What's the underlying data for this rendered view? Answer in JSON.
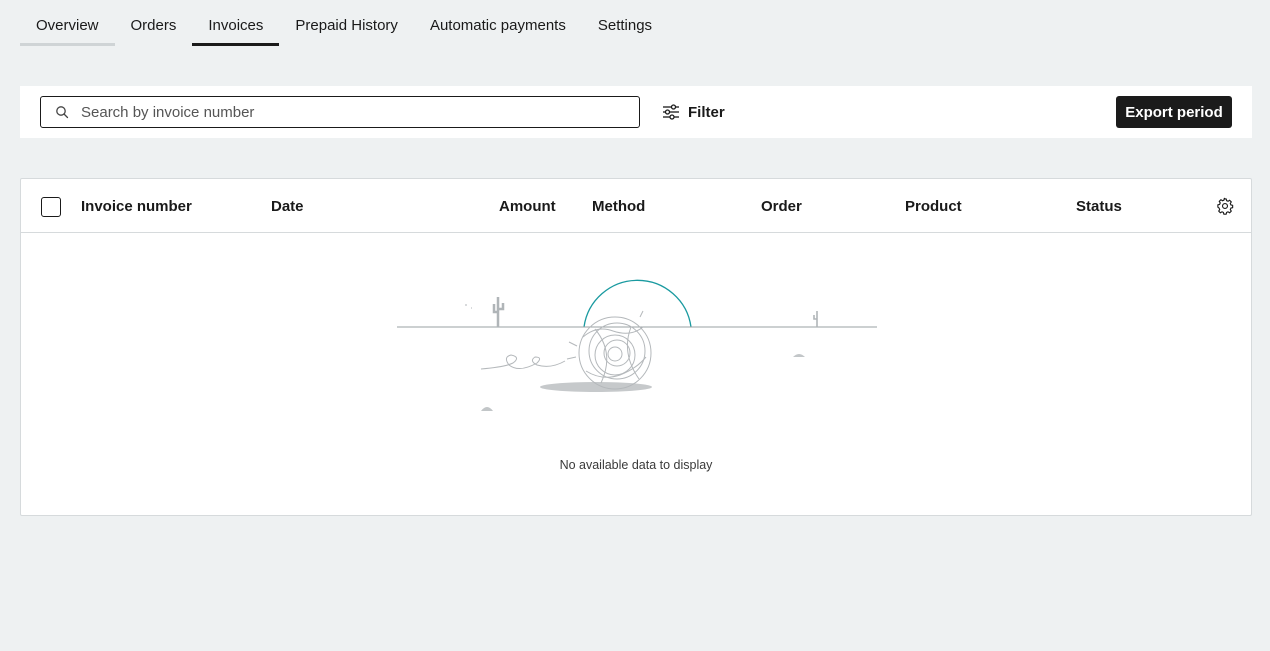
{
  "tabs": [
    {
      "label": "Overview"
    },
    {
      "label": "Orders"
    },
    {
      "label": "Invoices",
      "active": true
    },
    {
      "label": "Prepaid History"
    },
    {
      "label": "Automatic payments"
    },
    {
      "label": "Settings"
    }
  ],
  "toolbar": {
    "search_placeholder": "Search by invoice number",
    "search_value": "",
    "filter_label": "Filter",
    "export_label": "Export period"
  },
  "table": {
    "columns": [
      "Invoice number",
      "Date",
      "Amount",
      "Method",
      "Order",
      "Product",
      "Status"
    ],
    "rows": [],
    "empty_message": "No available data to display"
  },
  "colors": {
    "accent": "#1a9aa0",
    "primary_button": "#1b1b1b",
    "background": "#eef1f2"
  },
  "icons": [
    "search-icon",
    "filter-sliders-icon",
    "gear-icon",
    "desert-tumbleweed-illustration"
  ]
}
